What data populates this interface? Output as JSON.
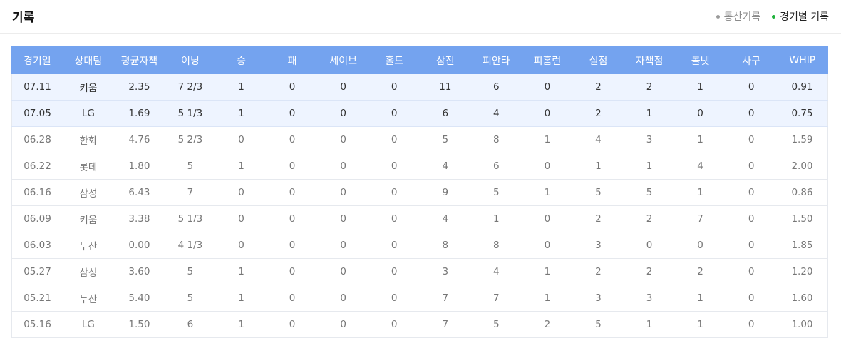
{
  "header": {
    "title": "기록",
    "toggle": {
      "career_label": "통산기록",
      "game_label": "경기별 기록"
    }
  },
  "colors": {
    "header_bg": "#74a3ef",
    "highlight_row_bg": "#eef4ff",
    "active_dot": "#1fb23c",
    "inactive_dot": "#9a9a9a"
  },
  "table": {
    "columns": [
      "경기일",
      "상대팀",
      "평균자책",
      "이닝",
      "승",
      "패",
      "세이브",
      "홀드",
      "삼진",
      "피안타",
      "피홈런",
      "실점",
      "자책점",
      "볼넷",
      "사구",
      "WHIP"
    ],
    "rows": [
      {
        "highlight": true,
        "cells": [
          "07.11",
          "키움",
          "2.35",
          "7 2/3",
          "1",
          "0",
          "0",
          "0",
          "11",
          "6",
          "0",
          "2",
          "2",
          "1",
          "0",
          "0.91"
        ]
      },
      {
        "highlight": true,
        "cells": [
          "07.05",
          "LG",
          "1.69",
          "5 1/3",
          "1",
          "0",
          "0",
          "0",
          "6",
          "4",
          "0",
          "2",
          "1",
          "0",
          "0",
          "0.75"
        ]
      },
      {
        "highlight": false,
        "cells": [
          "06.28",
          "한화",
          "4.76",
          "5 2/3",
          "0",
          "0",
          "0",
          "0",
          "5",
          "8",
          "1",
          "4",
          "3",
          "1",
          "0",
          "1.59"
        ]
      },
      {
        "highlight": false,
        "cells": [
          "06.22",
          "롯데",
          "1.80",
          "5",
          "1",
          "0",
          "0",
          "0",
          "4",
          "6",
          "0",
          "1",
          "1",
          "4",
          "0",
          "2.00"
        ]
      },
      {
        "highlight": false,
        "cells": [
          "06.16",
          "삼성",
          "6.43",
          "7",
          "0",
          "0",
          "0",
          "0",
          "9",
          "5",
          "1",
          "5",
          "5",
          "1",
          "0",
          "0.86"
        ]
      },
      {
        "highlight": false,
        "cells": [
          "06.09",
          "키움",
          "3.38",
          "5 1/3",
          "0",
          "0",
          "0",
          "0",
          "4",
          "1",
          "0",
          "2",
          "2",
          "7",
          "0",
          "1.50"
        ]
      },
      {
        "highlight": false,
        "cells": [
          "06.03",
          "두산",
          "0.00",
          "4 1/3",
          "0",
          "0",
          "0",
          "0",
          "8",
          "8",
          "0",
          "3",
          "0",
          "0",
          "0",
          "1.85"
        ]
      },
      {
        "highlight": false,
        "cells": [
          "05.27",
          "삼성",
          "3.60",
          "5",
          "1",
          "0",
          "0",
          "0",
          "3",
          "4",
          "1",
          "2",
          "2",
          "2",
          "0",
          "1.20"
        ]
      },
      {
        "highlight": false,
        "cells": [
          "05.21",
          "두산",
          "5.40",
          "5",
          "1",
          "0",
          "0",
          "0",
          "7",
          "7",
          "1",
          "3",
          "3",
          "1",
          "0",
          "1.60"
        ]
      },
      {
        "highlight": false,
        "cells": [
          "05.16",
          "LG",
          "1.50",
          "6",
          "1",
          "0",
          "0",
          "0",
          "7",
          "5",
          "2",
          "5",
          "1",
          "1",
          "0",
          "1.00"
        ]
      }
    ]
  }
}
